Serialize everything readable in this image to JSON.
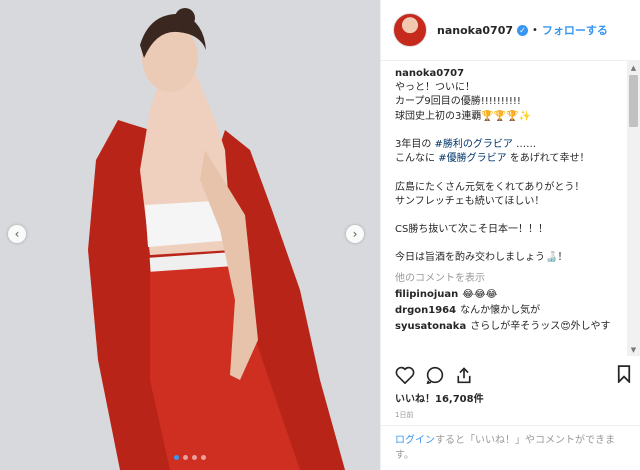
{
  "post": {
    "username": "nanoka0707",
    "dot": "•",
    "follow_label": "フォローする",
    "caption_username": "nanoka0707",
    "caption_lines": [
      [
        "やっと！ついに！"
      ],
      [
        "カープ9回目の優勝!!!!!!!!!!"
      ],
      [
        "球団史上初の3連覇🏆🏆🏆✨"
      ],
      [
        ""
      ],
      [
        "3年目の ",
        "#勝利のグラビア",
        " ……"
      ],
      [
        "こんなに ",
        "#優勝グラビア",
        " をあげれて幸せ！"
      ],
      [
        ""
      ],
      [
        "広島にたくさん元気をくれてありがとう！"
      ],
      [
        "サンフレッチェも続いてほしい！"
      ],
      [
        ""
      ],
      [
        "CS勝ち抜いて次こそ日本一！！！"
      ],
      [
        ""
      ],
      [
        "今日は旨酒を酌み交わしましょう🍶！"
      ]
    ],
    "view_more_comments": "他のコメントを表示",
    "comments": [
      {
        "user": "filipinojuan",
        "text": "😂😂😂"
      },
      {
        "user": "drgon1964",
        "text": "なんか懐かし気が"
      },
      {
        "user": "syusatonaka",
        "text": "さらしが辛そうッス😍外しやす"
      }
    ],
    "likes": "いいね！16,708件",
    "time_ago": "1日前",
    "login_link": "ログイン",
    "login_text": "すると「いいね！」やコメントができます。"
  },
  "media": {
    "nav_prev": "‹",
    "nav_next": "›",
    "carousel_count": 4,
    "active_index": 0
  },
  "colors": {
    "accent": "#3897f0",
    "outfit_red": "#c8291c",
    "background": "#d8d9dc"
  }
}
